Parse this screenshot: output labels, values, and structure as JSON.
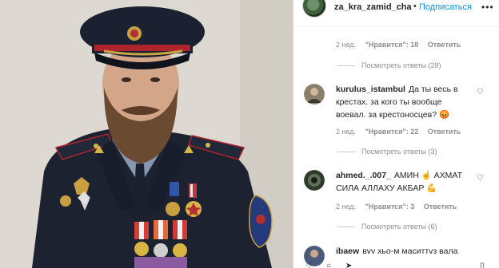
{
  "header": {
    "username": "za_kra_zamid_chala",
    "dot": "•",
    "follow_label": "Подписаться",
    "more": "•••"
  },
  "top_meta": {
    "time": "2 нед.",
    "likes": "\"Нравится\": 18",
    "reply": "Ответить"
  },
  "top_view_replies": "Посмотреть ответы (28)",
  "comments": [
    {
      "username": "kurulus_istambul",
      "text": "Да ты весь в крестах. за кого ты вообще воевал. за крестоносцев? 😡",
      "time": "2 нед.",
      "likes": "\"Нравится\": 22",
      "reply": "Ответить",
      "view_replies": "Посмотреть ответы (3)"
    },
    {
      "username": "ahmed._.007_",
      "text": "АМИН ☝️ АХМАТ СИЛА АЛЛАХУ АКБАР 💪",
      "time": "2 нед.",
      "likes": "\"Нравится\": 3",
      "reply": "Ответить",
      "view_replies": "Посмотреть ответы (6)"
    },
    {
      "username": "ibaew",
      "text": "вvv хьо-м маситтvз вала"
    }
  ],
  "icons": {
    "heart": "♡",
    "comment": "○",
    "share": "➤",
    "bookmark": "▯"
  },
  "colors": {
    "follow_blue": "#0095f6",
    "muted": "#8e8e8e",
    "text": "#262626"
  }
}
